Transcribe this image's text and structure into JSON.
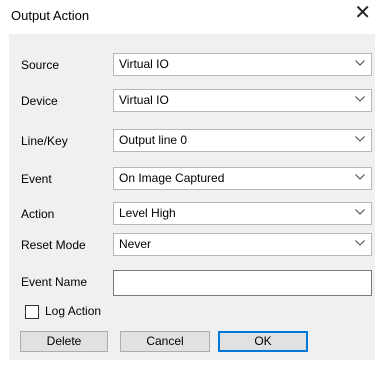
{
  "window": {
    "title": "Output Action",
    "close_icon": "close-icon"
  },
  "fields": [
    {
      "key": "source",
      "label": "Source",
      "value": "Virtual IO"
    },
    {
      "key": "device",
      "label": "Device",
      "value": "Virtual IO"
    },
    {
      "key": "line_key",
      "label": "Line/Key",
      "value": "Output line 0"
    },
    {
      "key": "event",
      "label": "Event",
      "value": "On Image Captured"
    },
    {
      "key": "action",
      "label": "Action",
      "value": "Level High"
    },
    {
      "key": "reset_mode",
      "label": "Reset Mode",
      "value": "Never"
    }
  ],
  "event_name": {
    "label": "Event Name",
    "value": ""
  },
  "log_action": {
    "label": "Log Action",
    "checked": false
  },
  "buttons": {
    "delete": "Delete",
    "cancel": "Cancel",
    "ok": "OK"
  },
  "colors": {
    "ok_border": "#0078d7",
    "panel": "#f0f0f0"
  }
}
